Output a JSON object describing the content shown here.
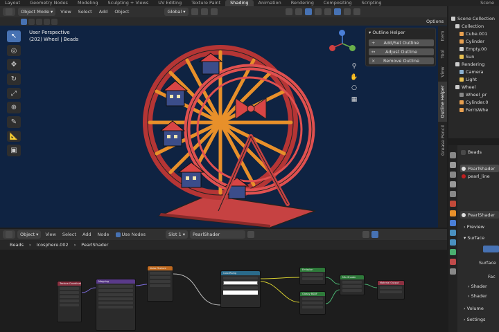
{
  "workspace_tabs": [
    "Layout",
    "Geometry Nodes",
    "Modeling",
    "Sculpting + Views",
    "UV Editing",
    "Texture Paint",
    "Shading",
    "Animation",
    "Rendering",
    "Compositing",
    "Scripting"
  ],
  "active_tab": "Shading",
  "scene_label": "Scene",
  "viewport_header": {
    "mode": "Object Mode",
    "menus": [
      "View",
      "Select",
      "Add",
      "Object"
    ],
    "transform_orientation": "Global",
    "options_label": "Options"
  },
  "viewport": {
    "perspective": "User Perspective",
    "object_info": "(202) Wheel | Beads"
  },
  "outline_helper": {
    "title": "Outline Helper",
    "buttons": [
      {
        "icon": "+",
        "label": "Add/Set Outline"
      },
      {
        "icon": "↔",
        "label": "Adjust Outline"
      },
      {
        "icon": "×",
        "label": "Remove Outline"
      }
    ]
  },
  "side_tabs": [
    "Item",
    "Tool",
    "View",
    "Outline Helper",
    "Grease Pencil"
  ],
  "node_editor_header": {
    "type": "Object",
    "menus": [
      "View",
      "Select",
      "Add",
      "Node"
    ],
    "use_nodes_label": "Use Nodes",
    "slot": "Slot 1",
    "material": "PearlShader"
  },
  "node_breadcrumb": [
    "Beads",
    "Icosphere.002",
    "PearlShader"
  ],
  "nodes": [
    {
      "title": "Texture Coordinate",
      "color": "#8b3040"
    },
    {
      "title": "Mapping",
      "color": "#5a3a8a"
    },
    {
      "title": "Noise Texture",
      "color": "#c06a20"
    },
    {
      "title": "ColorRamp",
      "color": "#2a6a8a"
    },
    {
      "title": "Emission",
      "color": "#2e7a3a"
    },
    {
      "title": "Mix Shader",
      "color": "#2e7a3a"
    },
    {
      "title": "Material Output",
      "color": "#8b3040"
    },
    {
      "title": "Glossy BSDF",
      "color": "#2e7a3a"
    }
  ],
  "outliner": {
    "rows": [
      {
        "label": "Scene Collection",
        "depth": 0,
        "color": "#cccccc"
      },
      {
        "label": "Collection",
        "depth": 1,
        "color": "#cccccc"
      },
      {
        "label": "Cube.001",
        "depth": 2,
        "color": "#e8a050"
      },
      {
        "label": "Cylinder",
        "depth": 2,
        "color": "#e8a050"
      },
      {
        "label": "Empty.00",
        "depth": 2,
        "color": "#cccccc"
      },
      {
        "label": "Sun",
        "depth": 2,
        "color": "#e8c050"
      },
      {
        "label": "Rendering",
        "depth": 1,
        "color": "#cccccc"
      },
      {
        "label": "Camera",
        "depth": 2,
        "color": "#8ab0d0"
      },
      {
        "label": "Light",
        "depth": 2,
        "color": "#e8c050"
      },
      {
        "label": "Wheel",
        "depth": 1,
        "color": "#cccccc"
      },
      {
        "label": "Wheel_pr",
        "depth": 2,
        "color": "#888888"
      },
      {
        "label": "Cylinder.0",
        "depth": 2,
        "color": "#e8a050"
      },
      {
        "label": "FerrisWhe",
        "depth": 2,
        "color": "#e8a050"
      }
    ]
  },
  "properties": {
    "object": "Beads",
    "materials": [
      "PearlShader",
      "pearl_line"
    ],
    "active_material": "PearlShader",
    "sections": [
      "Preview",
      "Surface",
      "Volume",
      "Settings"
    ],
    "surface_label": "Surface",
    "fac_label": "Fac",
    "shader_labels": [
      "Shader",
      "Shader"
    ]
  },
  "colors": {
    "accent": "#4772b3",
    "viewport_bg": "#0f2342",
    "wheel_red": "#d94545",
    "spoke_orange": "#e8902a"
  }
}
